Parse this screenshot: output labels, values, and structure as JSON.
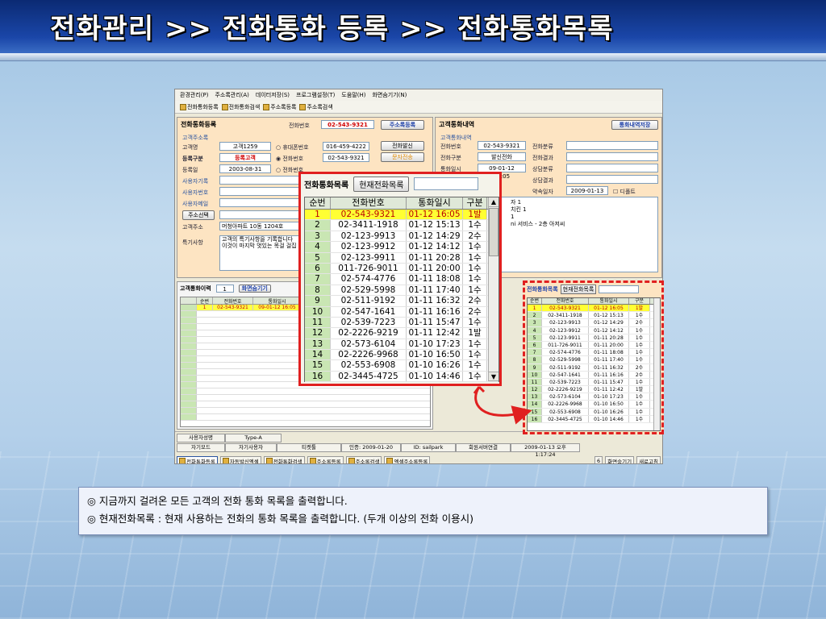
{
  "header": {
    "title": "전화관리 >> 전화통화 등록 >> 전화통화목록"
  },
  "app": {
    "menu": [
      "환경관리(P)",
      "주소록관리(A)",
      "데이터저장(S)",
      "프로그램설정(T)",
      "도움말(H)",
      "화면숨기기(N)"
    ],
    "toolbar": [
      "전화통화등록",
      "전화통화검색",
      "주소록등록",
      "주소록검색"
    ],
    "left_panel": {
      "title": "전화통화등록",
      "phone_label": "전화번호",
      "phone_value": "02-543-9321",
      "register_button": "주소록등록",
      "section_label": "고객주소록",
      "customer_name_label": "고객명",
      "customer_name_value": "고객1259",
      "radio_mobile": "휴대폰번호",
      "radio_phone": "전화번호",
      "radio_phone2": "전화번호",
      "mobile_value": "016-459-4222",
      "phone2_value": "02-543-9321",
      "call_button": "전화발신",
      "sms_button": "문자전송",
      "grade_label": "등록구분",
      "grade_value": "등록고객",
      "date_label": "등록일",
      "date_value": "2003-08-31",
      "user_record_label": "사용자기록",
      "user_phone_label": "사용자번호",
      "user_mail_label": "사용자메일",
      "address_select_button": "주소선택",
      "address_label": "고객주소",
      "address_value": "머청아파트 10동 1204호",
      "special_label": "특기사항",
      "special_value": "고객의 특기사항을 기록합니다 이것이 마지막 멋있는 목걸 걸집"
    },
    "right_panel": {
      "title": "고객통화내역",
      "save_button": "통화내역저장",
      "section_label": "고객통화내역",
      "phone_label": "전화번호",
      "phone_value": "02-543-9321",
      "type_label": "전화구분",
      "type_value": "발신전화",
      "datetime_label": "통화일시",
      "datetime_value": "09-01-12 16:05",
      "category_label": "전화분류",
      "result_label": "전화결과",
      "consult_label": "상담분류",
      "consult_result_label": "상담결과",
      "appointment_label": "약속일자",
      "appointment_value": "2009-01-13",
      "alarm_label": "디폴트",
      "memo_lines": [
        "자 1",
        "치킨 1",
        "1",
        "ni 서비스 - 2층 아저씨"
      ]
    },
    "history": {
      "title": "고객통화이력",
      "count": "1",
      "hide_button": "화면숨기기",
      "columns": [
        "순번",
        "전화번호",
        "통화일시",
        "구"
      ],
      "rows": [
        [
          "1",
          "02-543-9321",
          "09-01-12 16:05",
          "발"
        ]
      ]
    },
    "status": {
      "row1": [
        "사용자성명",
        "Type-A"
      ],
      "row2": [
        "자기모드",
        "자기사용자",
        "티켓툴",
        "인증: 2009-01-20",
        "ID: sailpark",
        "회원서버연결",
        "2009-01-13 오후 1:17:24"
      ],
      "tasks": [
        "전화통화등록",
        "자동발신엑셀",
        "전화통화검색",
        "주소록등록",
        "주소록검색",
        "엑셀주소록등록"
      ],
      "right_tasks": [
        "6",
        "화면숨기기",
        "새로고침"
      ]
    }
  },
  "popup": {
    "title": "전화통화목록",
    "button": "현재전화목록",
    "columns": [
      "순번",
      "전화번호",
      "통화일시",
      "구분"
    ],
    "rows": [
      [
        "1",
        "02-543-9321",
        "01-12 16:05",
        "1발"
      ],
      [
        "2",
        "02-3411-1918",
        "01-12 15:13",
        "1수"
      ],
      [
        "3",
        "02-123-9913",
        "01-12 14:29",
        "2수"
      ],
      [
        "4",
        "02-123-9912",
        "01-12 14:12",
        "1수"
      ],
      [
        "5",
        "02-123-9911",
        "01-11 20:28",
        "1수"
      ],
      [
        "6",
        "011-726-9011",
        "01-11 20:00",
        "1수"
      ],
      [
        "7",
        "02-574-4776",
        "01-11 18:08",
        "1수"
      ],
      [
        "8",
        "02-529-5998",
        "01-11 17:40",
        "1수"
      ],
      [
        "9",
        "02-511-9192",
        "01-11 16:32",
        "2수"
      ],
      [
        "10",
        "02-547-1641",
        "01-11 16:16",
        "2수"
      ],
      [
        "11",
        "02-539-7223",
        "01-11 15:47",
        "1수"
      ],
      [
        "12",
        "02-2226-9219",
        "01-11 12:42",
        "1발"
      ],
      [
        "13",
        "02-573-6104",
        "01-10 17:23",
        "1수"
      ],
      [
        "14",
        "02-2226-9968",
        "01-10 16:50",
        "1수"
      ],
      [
        "15",
        "02-553-6908",
        "01-10 16:26",
        "1수"
      ],
      [
        "16",
        "02-3445-4725",
        "01-10 14:46",
        "1수"
      ]
    ]
  },
  "dashed_panel": {
    "title": "전화통화목록",
    "button": "현재전화목록",
    "columns": [
      "순번",
      "전화번호",
      "통화일시",
      "구분"
    ]
  },
  "notes": [
    "◎ 지금까지 걸려온 모든 고객의 전화 통화 목록을 출력합니다.",
    "◎ 현재전화목록 : 현재 사용하는 전화의 통화 목록을 출력합니다. (두개 이상의 전화 이용시)"
  ]
}
